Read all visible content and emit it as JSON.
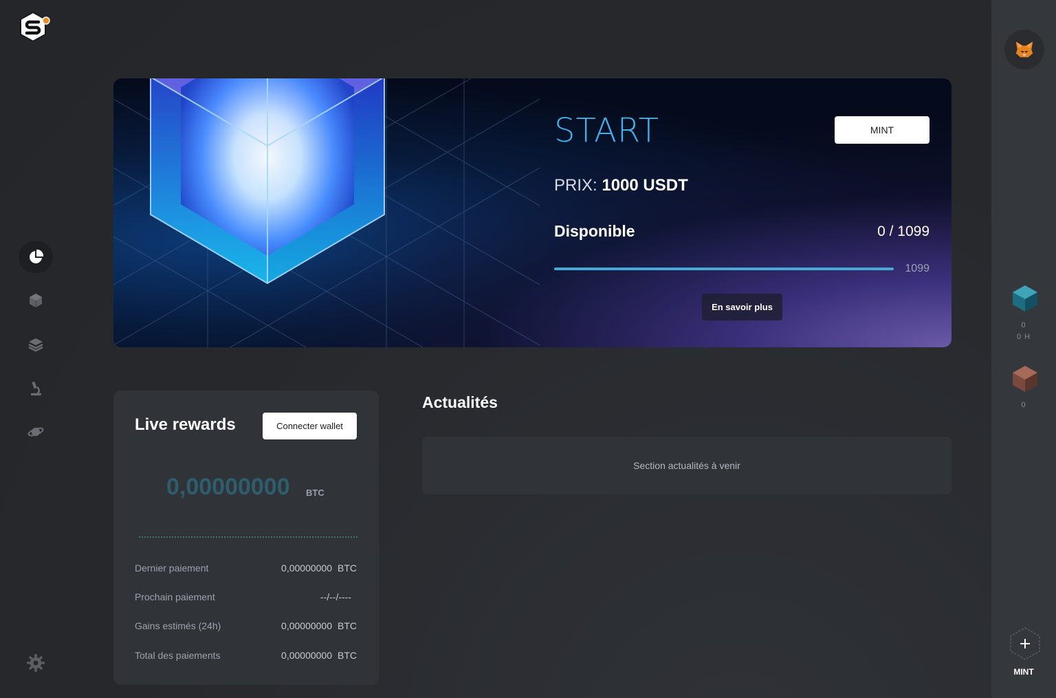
{
  "colors": {
    "accent_blue": "#3fb0ea",
    "progress": "#47a9d6",
    "btc_amount": "#2e5e6d",
    "card_bg": "#303338",
    "sidebar_right_bg": "#34373b"
  },
  "sidebar_left": {
    "logo_icon": "s-hex-logo-icon",
    "items": [
      {
        "icon": "pie-chart-icon",
        "active": true
      },
      {
        "icon": "cube-icon",
        "active": false
      },
      {
        "icon": "layers-icon",
        "active": false
      },
      {
        "icon": "microscope-icon",
        "active": false
      },
      {
        "icon": "planet-icon",
        "active": false
      }
    ],
    "settings_icon": "gear-icon"
  },
  "hero": {
    "title": "START",
    "mint_label": "MINT",
    "price_label": "PRIX:",
    "price_value": "1000 USDT",
    "available_label": "Disponible",
    "available_count": "0 / 1099",
    "progress_fraction": 1.0,
    "progress_label": "1099",
    "learn_more_label": "En savoir plus"
  },
  "rewards": {
    "title": "Live rewards",
    "connect_label": "Connecter wallet",
    "amount": "0,00000000",
    "amount_unit": "BTC",
    "rows": [
      {
        "label": "Dernier paiement",
        "value": "0,00000000",
        "unit": "BTC"
      },
      {
        "label": "Prochain paiement",
        "value": "--/--/----",
        "unit": ""
      },
      {
        "label": "Gains estimés (24h)",
        "value": "0,00000000",
        "unit": "BTC"
      },
      {
        "label": "Total des paiements",
        "value": "0,00000000",
        "unit": "BTC"
      }
    ]
  },
  "news": {
    "title": "Actualités",
    "placeholder": "Section actualités à venir"
  },
  "sidebar_right": {
    "wallet_icon": "metamask-fox-icon",
    "cube1": {
      "count": "0",
      "hashrate": "0 H"
    },
    "cube2": {
      "count": "0"
    },
    "mint_label": "MINT",
    "mint_icon": "plus-icon"
  }
}
